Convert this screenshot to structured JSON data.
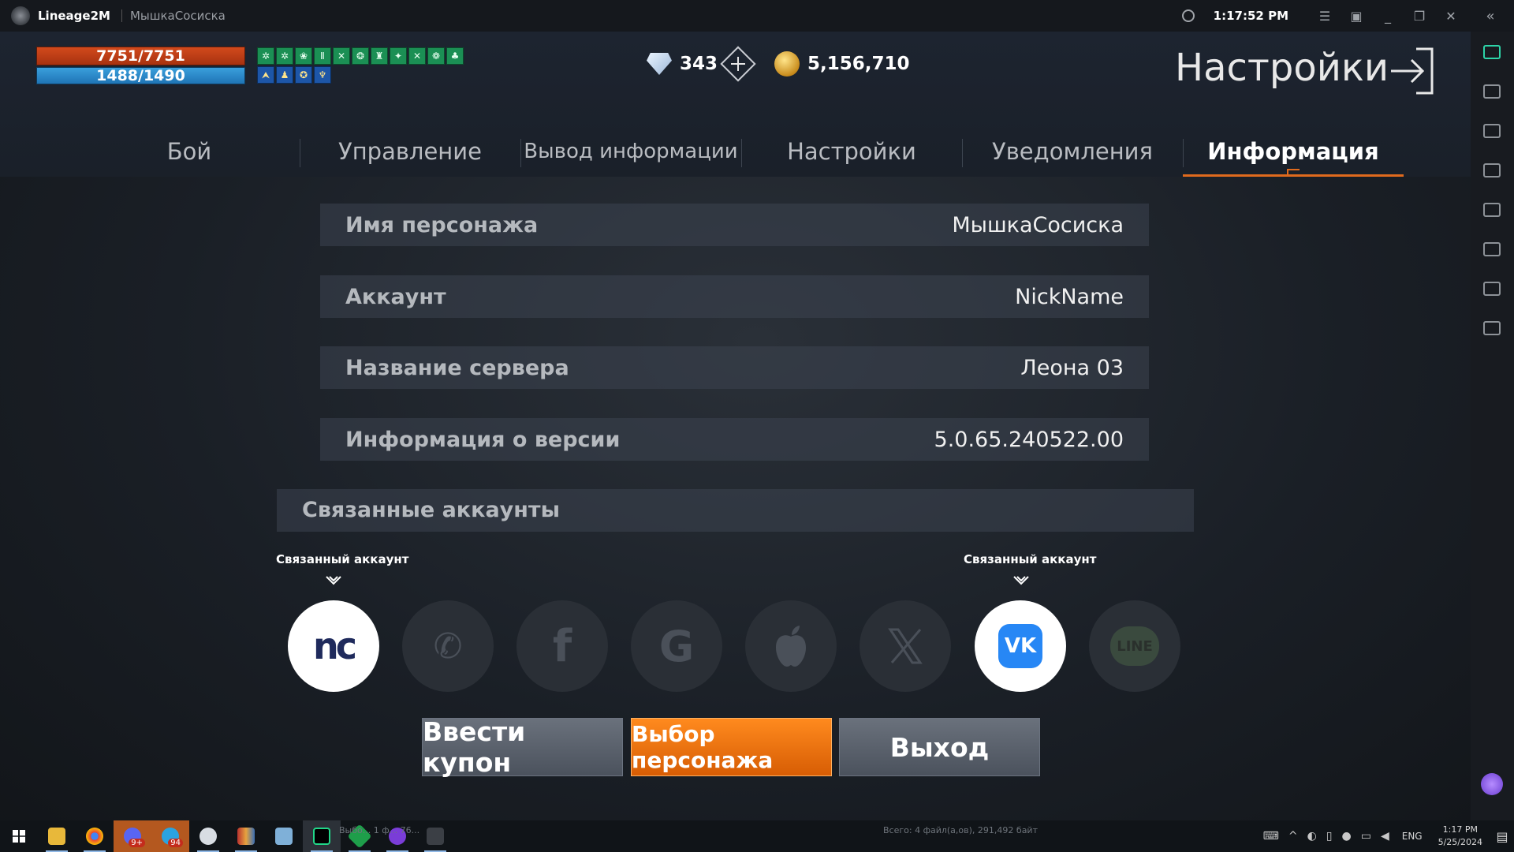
{
  "window": {
    "app_name": "Lineage2M",
    "character": "МышкаСосиска",
    "time": "1:17:52 PM"
  },
  "hud": {
    "hp": "7751/7751",
    "mp": "1488/1490",
    "diamonds": "343",
    "adena": "5,156,710",
    "buff_icons": [
      "✲",
      "✲",
      "❀",
      "Ⅱ",
      "✕",
      "❂",
      "♜",
      "✦",
      "✕",
      "❁",
      "♣"
    ],
    "debuff_icons": [
      "⮝",
      "♟",
      "✪",
      "♆"
    ]
  },
  "header": {
    "title": "Настройки"
  },
  "tabs": [
    {
      "label": "Бой"
    },
    {
      "label": "Управление"
    },
    {
      "label": "Вывод информации"
    },
    {
      "label": "Настройки"
    },
    {
      "label": "Уведомления"
    },
    {
      "label": "Информация"
    }
  ],
  "info": {
    "rows": [
      {
        "key": "Имя персонажа",
        "value": "МышкаСосиска"
      },
      {
        "key": "Аккаунт",
        "value": "NickName"
      },
      {
        "key": "Название сервера",
        "value": "Леона 03"
      },
      {
        "key": "Информация о версии",
        "value": "5.0.65.240522.00"
      }
    ],
    "linked_header": "Связанные аккаунты",
    "linked_label": "Связанный аккаунт",
    "social": [
      {
        "name": "nc",
        "glyph": "nc",
        "linked": true
      },
      {
        "name": "phone",
        "glyph": "✆",
        "linked": false
      },
      {
        "name": "facebook",
        "glyph": "f",
        "linked": false
      },
      {
        "name": "google",
        "glyph": "G",
        "linked": false
      },
      {
        "name": "apple",
        "glyph": "",
        "linked": false
      },
      {
        "name": "x",
        "glyph": "𝕏",
        "linked": false
      },
      {
        "name": "vk",
        "glyph": "VK",
        "linked": true
      },
      {
        "name": "line",
        "glyph": "LINE",
        "linked": false
      }
    ]
  },
  "buttons": {
    "coupon": "Ввести купон",
    "select_char": "Выбор персонажа",
    "exit": "Выход"
  },
  "taskbar": {
    "status_text": "Всего: 4 файл(а,ов), 291,492 байт",
    "background_text": "Выбо... 1 ф... 76...",
    "lang": "ENG",
    "time": "1:17 PM",
    "date": "5/25/2024",
    "badges": {
      "app3": "9+",
      "telegram": "94"
    }
  },
  "colors": {
    "accent": "#e06a1d",
    "hp": "#d24a1c",
    "mp": "#3a9fdc",
    "vk": "#2787f5",
    "nc": "#1f2a5c"
  }
}
